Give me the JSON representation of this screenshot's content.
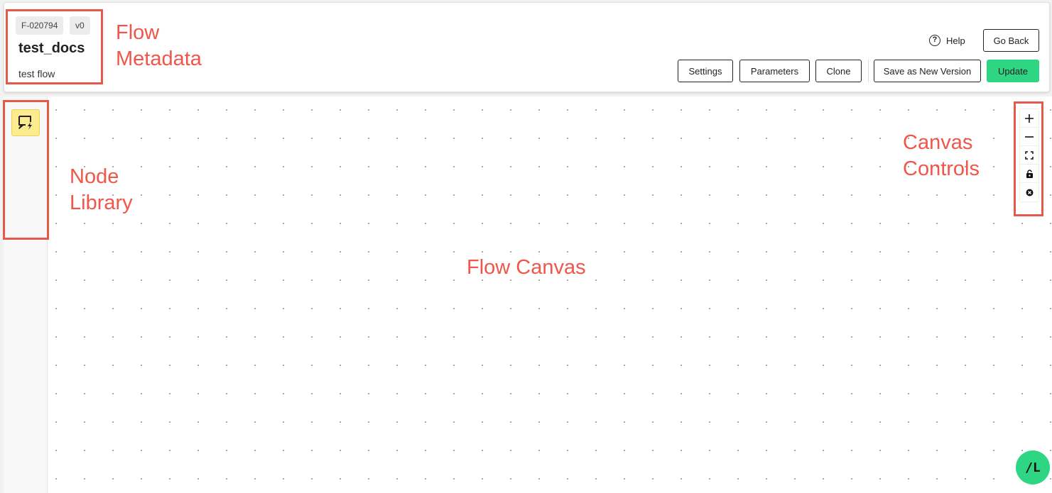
{
  "flow": {
    "id": "F-020794",
    "version": "v0",
    "title": "test_docs",
    "description": "test flow"
  },
  "header": {
    "help_label": "Help",
    "go_back_label": "Go Back",
    "settings_label": "Settings",
    "parameters_label": "Parameters",
    "clone_label": "Clone",
    "save_new_version_label": "Save as New Version",
    "update_label": "Update"
  },
  "canvas_controls": [
    "zoom-in-icon",
    "zoom-out-icon",
    "fit-view-icon",
    "lock-icon",
    "reset-icon"
  ],
  "bubble_label": "/L",
  "colors": {
    "accent_green": "#2ed582",
    "annotation_red": "#e8584a",
    "node_library_yellow": "#fdec8f"
  },
  "annotations": {
    "flow_metadata_line1": "Flow",
    "flow_metadata_line2": "Metadata",
    "node_library_line1": "Node",
    "node_library_line2": "Library",
    "flow_canvas": "Flow Canvas",
    "canvas_controls_line1": "Canvas",
    "canvas_controls_line2": "Controls"
  }
}
